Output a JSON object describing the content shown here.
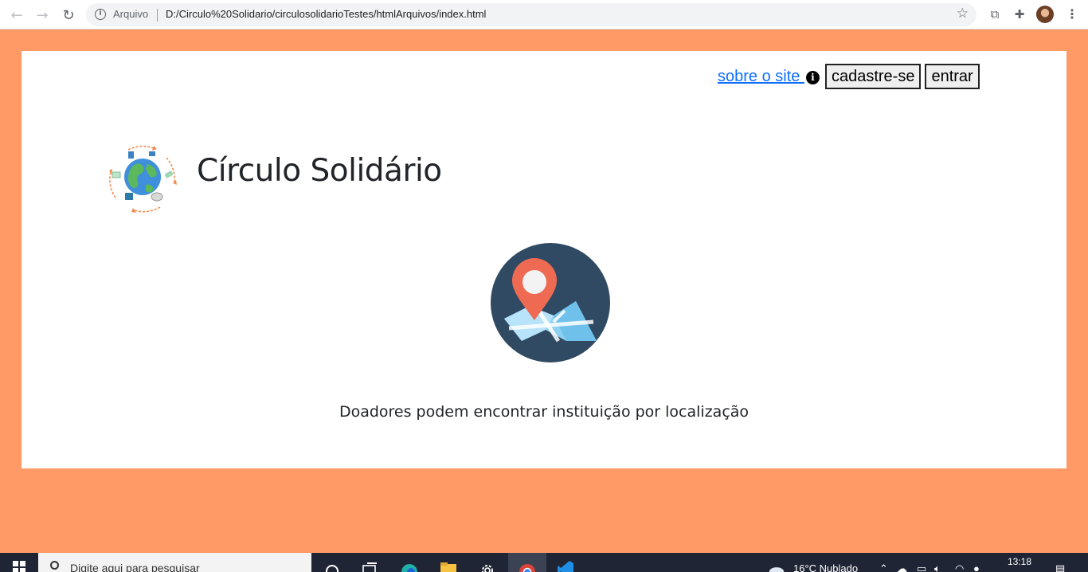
{
  "browser": {
    "scheme_label": "Arquivo",
    "url": "D:/Circulo%20Solidario/circulosolidarioTestes/htmlArquivos/index.html"
  },
  "page": {
    "nav": {
      "about_label": "sobre o site ",
      "info_glyph": "i",
      "signup_label": "cadastre-se",
      "login_label": "entrar"
    },
    "title": "Círculo Solidário",
    "feature_text": "Doadores podem encontrar instituição por localização",
    "colors": {
      "page_background": "#ff9966",
      "link": "#0d6efd",
      "map_circle": "#2f4a62",
      "pin": "#ef6a52"
    }
  },
  "taskbar": {
    "search_placeholder": "Digite aqui para pesquisar",
    "weather": "16°C  Nublado",
    "time": "13:18"
  }
}
